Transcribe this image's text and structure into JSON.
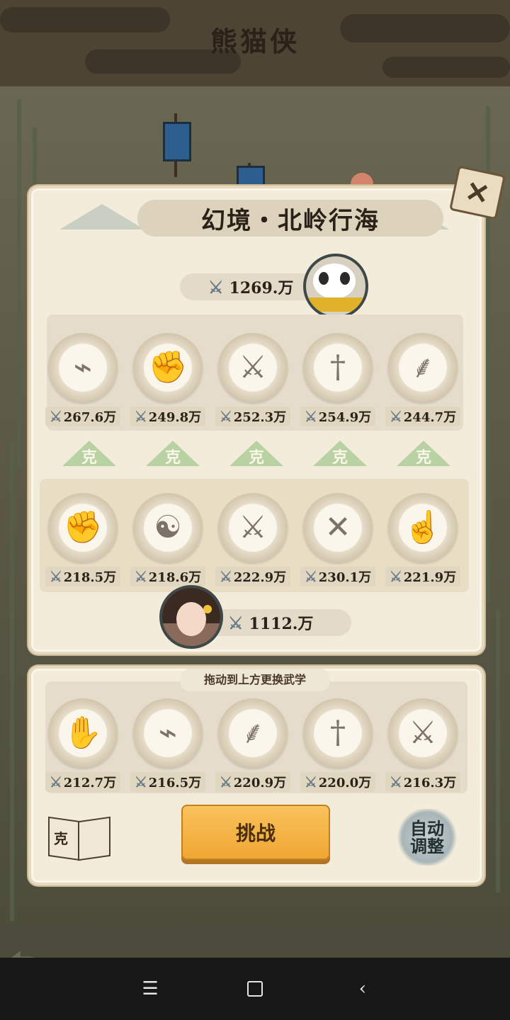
{
  "game_title": "熊猫侠",
  "region_title": "幻境・北岭行海",
  "enemy_power": "1269.万",
  "player_power": "1112.万",
  "enemy_skills": [
    {
      "icon": "shoe-icon",
      "glyph": "⌁",
      "power": "267.6万"
    },
    {
      "icon": "fist-icon",
      "glyph": "✊",
      "power": "249.8万"
    },
    {
      "icon": "darts-icon",
      "glyph": "⚔",
      "power": "252.3万"
    },
    {
      "icon": "sword-icon",
      "glyph": "†",
      "power": "254.9万"
    },
    {
      "icon": "feather-icon",
      "glyph": "⸙",
      "power": "244.7万"
    }
  ],
  "counter_label": "克",
  "player_skills": [
    {
      "icon": "fist-icon",
      "glyph": "✊",
      "power": "218.5万"
    },
    {
      "icon": "meditation-icon",
      "glyph": "☯",
      "power": "218.6万"
    },
    {
      "icon": "saber-icon",
      "glyph": "⚔",
      "power": "222.9万"
    },
    {
      "icon": "crossed-spears-icon",
      "glyph": "✕",
      "power": "230.1万"
    },
    {
      "icon": "finger-icon",
      "glyph": "☝",
      "power": "221.9万"
    }
  ],
  "hint": "拖动到上方更换武学",
  "reserve_skills": [
    {
      "icon": "palm-icon",
      "glyph": "✋",
      "power": "212.7万"
    },
    {
      "icon": "shoe-icon",
      "glyph": "⌁",
      "power": "216.5万"
    },
    {
      "icon": "feather-icon",
      "glyph": "⸙",
      "power": "220.9万"
    },
    {
      "icon": "sword-icon",
      "glyph": "†",
      "power": "220.0万"
    },
    {
      "icon": "darts-icon",
      "glyph": "⚔",
      "power": "216.3万"
    }
  ],
  "book_label": "克",
  "challenge_label": "挑战",
  "auto_label_1": "自动",
  "auto_label_2": "调整",
  "close_label": "✕",
  "colors": {
    "accent": "#f0a733",
    "counter_green": "#b9d2a4",
    "panel": "#f4ecdb"
  }
}
